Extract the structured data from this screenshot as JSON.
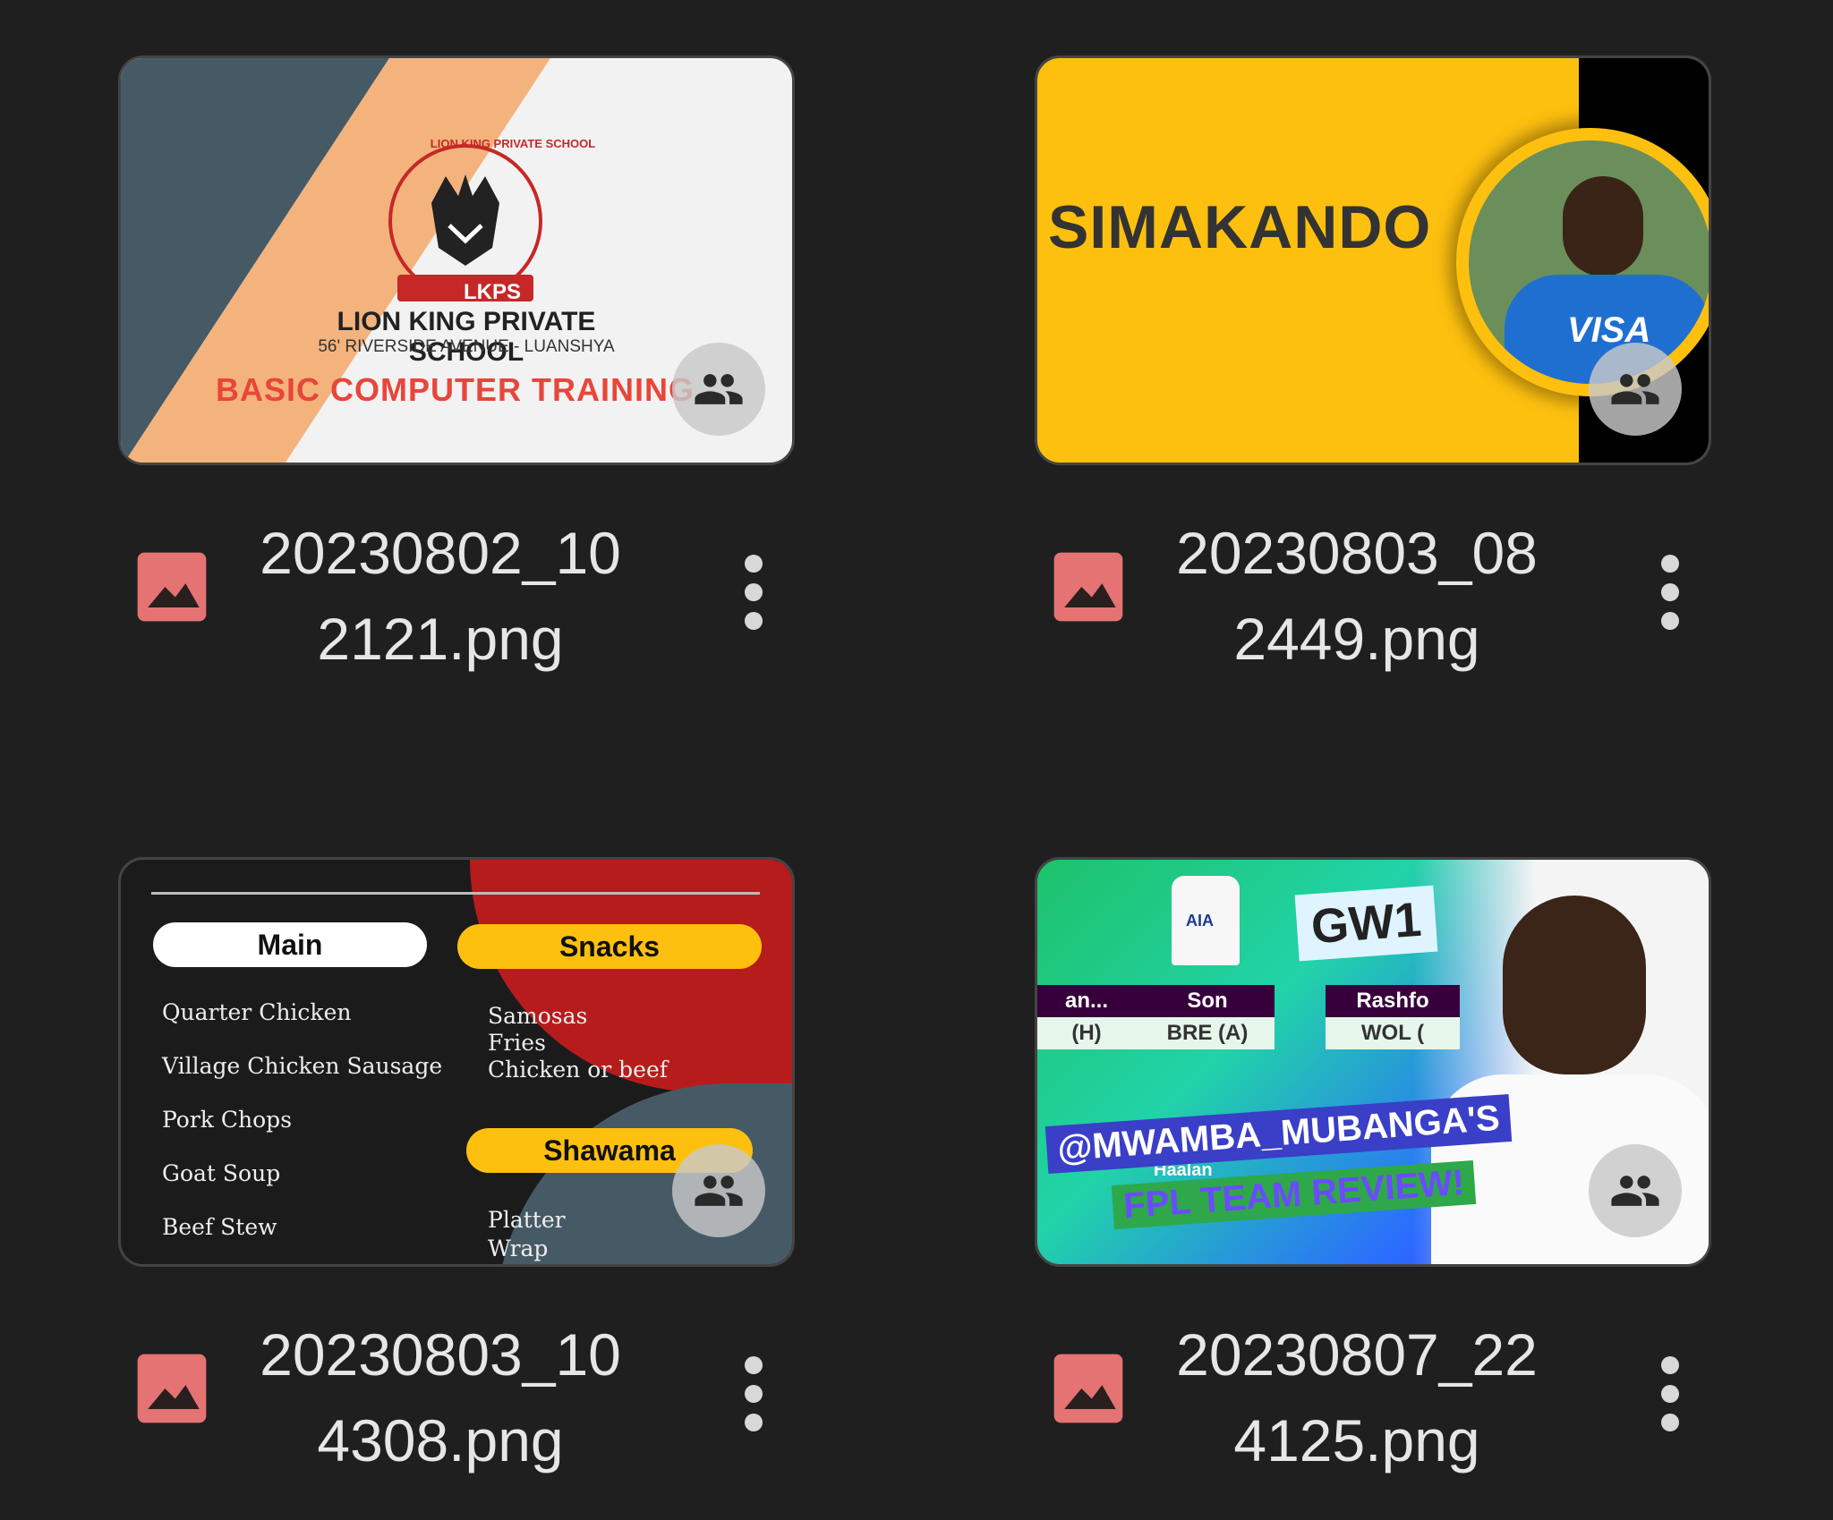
{
  "files": [
    {
      "name": "20230802_102121.png",
      "thumb": {
        "school_name": "LION KING PRIVATE SCHOOL",
        "address": "56' RIVERSIDE AVENUE - LUANSHYA",
        "course": "BASIC COMPUTER TRAINING",
        "logo_text": "LION KING PRIVATE SCHOOL",
        "logo_abbr": "LKPS"
      }
    },
    {
      "name": "20230803_082449.png",
      "thumb": {
        "brand": "SIMAKANDO",
        "shirt_text": "VISA"
      }
    },
    {
      "name": "20230803_104308.png",
      "thumb": {
        "main_label": "Main",
        "snacks_label": "Snacks",
        "shawama_label": "Shawama",
        "main_items": [
          "Quarter Chicken",
          "Village Chicken Sausage",
          "Pork Chops",
          "Goat Soup",
          "Beef Stew"
        ],
        "snacks_items": [
          "Samosas",
          "Fries",
          "Chicken or beef"
        ],
        "shawama_items": [
          "Platter",
          "Wrap"
        ]
      }
    },
    {
      "name": "20230807_224125.png",
      "thumb": {
        "gameweek": "GW1",
        "shirt_sponsor": "AIA",
        "players": [
          {
            "name": "an...",
            "fixture": "(H)"
          },
          {
            "name": "Son",
            "fixture": "BRE (A)"
          },
          {
            "name": "Rashfo",
            "fixture": "WOL ("
          }
        ],
        "handle": "@MWAMBA_MUBANGA'S",
        "subtitle": "FPL TEAM REVIEW!",
        "partial_name": "Haalan"
      }
    }
  ],
  "colors": {
    "background": "#1f1f1f",
    "image_icon": "#e57373",
    "text": "#e6e6e6"
  },
  "icons": {
    "file_type": "image-icon",
    "shared": "people-icon",
    "more": "more-vert-icon"
  }
}
